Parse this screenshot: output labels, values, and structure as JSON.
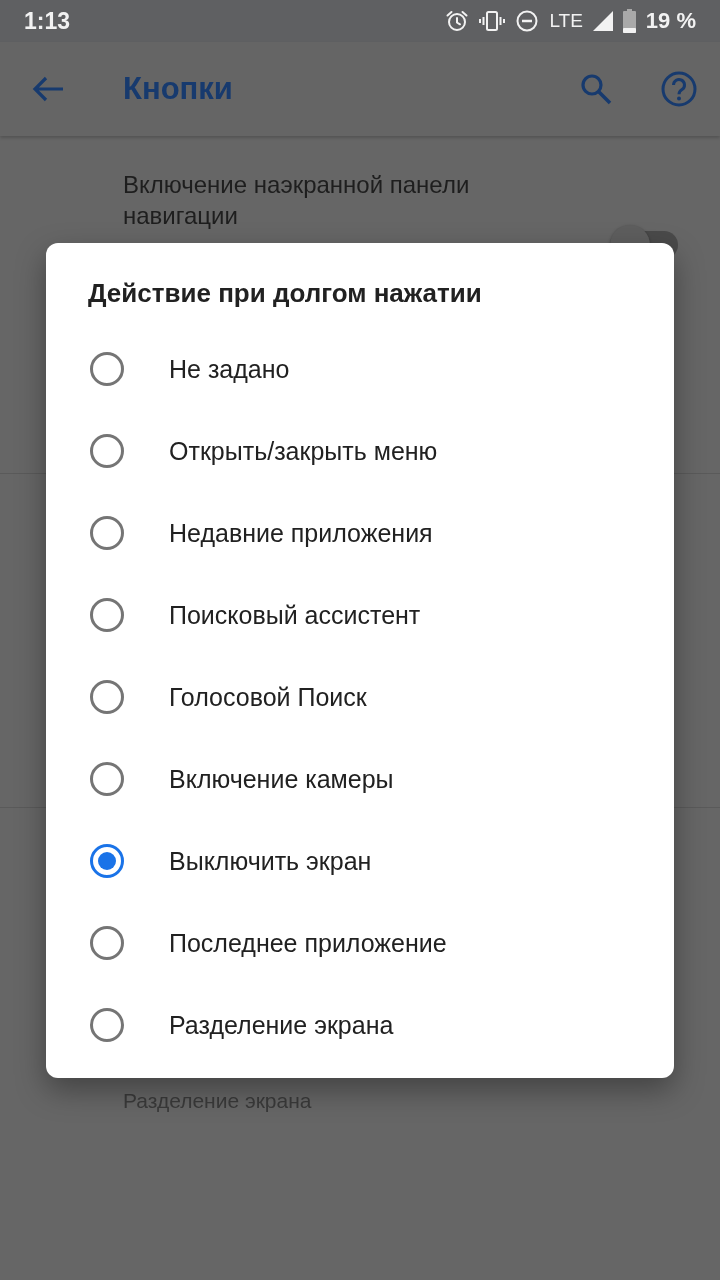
{
  "status_bar": {
    "time": "1:13",
    "network": "LTE",
    "battery": "19 %"
  },
  "app_bar": {
    "title": "Кнопки"
  },
  "settings": [
    {
      "kind": "toggle",
      "title": "Включение наэкранной панели навигации",
      "on": false
    },
    {
      "kind": "summary",
      "summary": "Разделение экрана"
    }
  ],
  "dialog": {
    "title": "Действие при долгом нажатии",
    "options": [
      {
        "label": "Не задано",
        "selected": false
      },
      {
        "label": "Открыть/закрыть меню",
        "selected": false
      },
      {
        "label": "Недавние приложения",
        "selected": false
      },
      {
        "label": "Поисковый ассистент",
        "selected": false
      },
      {
        "label": "Голосовой Поиск",
        "selected": false
      },
      {
        "label": "Включение камеры",
        "selected": false
      },
      {
        "label": "Выключить экран",
        "selected": true
      },
      {
        "label": "Последнее приложение",
        "selected": false
      },
      {
        "label": "Разделение экрана",
        "selected": false
      }
    ]
  }
}
